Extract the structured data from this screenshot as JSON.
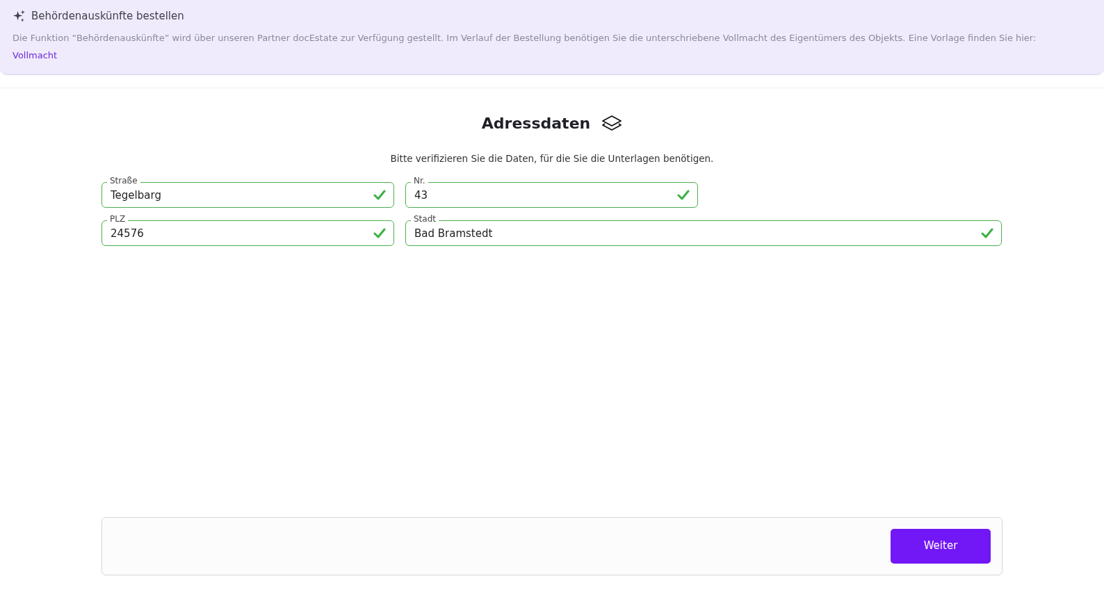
{
  "banner": {
    "title": "Behördenauskünfte bestellen",
    "text": "Die Funktion “Behördenauskünfte” wird über unseren Partner docEstate zur Verfügung gestellt. Im Verlauf der Bestellung benötigen Sie die unterschriebene Vollmacht des Eigentümers des Objekts. Eine Vorlage finden Sie hier:",
    "link": "Vollmacht"
  },
  "form": {
    "title": "Adressdaten",
    "subtitle": "Bitte verifizieren Sie die Daten, für die Sie die Unterlagen benötigen.",
    "fields": [
      {
        "label": "Straße",
        "value": "Tegelbarg",
        "valid": true
      },
      {
        "label": "Nr.",
        "value": "43",
        "valid": true
      },
      {
        "label": "PLZ",
        "value": "24576",
        "valid": true
      },
      {
        "label": "Stadt",
        "value": "Bad Bramstedt",
        "valid": true
      }
    ]
  },
  "footer": {
    "button": "Weiter"
  }
}
